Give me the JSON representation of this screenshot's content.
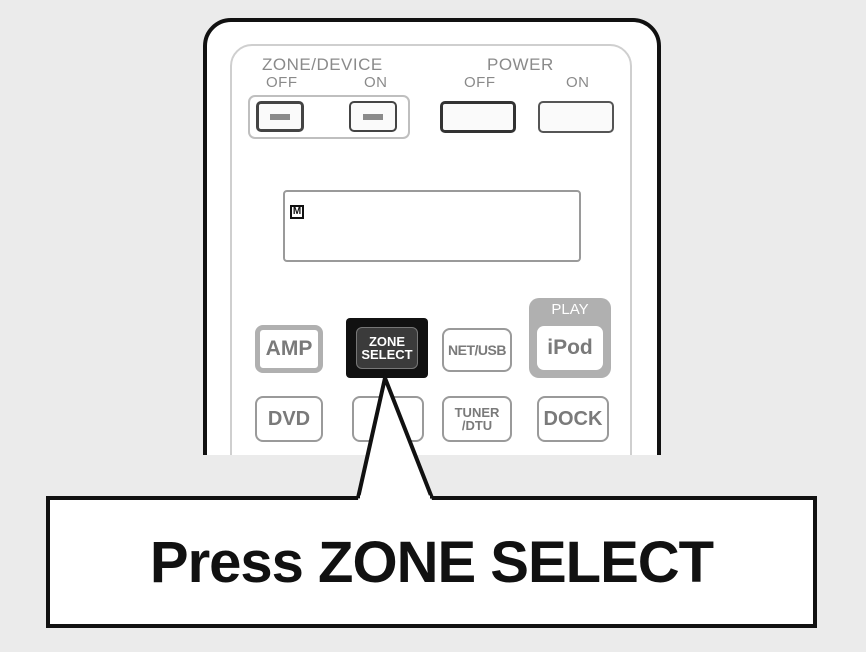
{
  "remote": {
    "zone_device_label": "ZONE/DEVICE",
    "zone_off_label": "OFF",
    "zone_on_label": "ON",
    "power_label": "POWER",
    "power_off_label": "OFF",
    "power_on_label": "ON",
    "display_indicator": "M",
    "buttons": {
      "amp": "AMP",
      "zone_select_line1": "ZONE",
      "zone_select_line2": "SELECT",
      "net_usb": "NET/USB",
      "play": "PLAY",
      "ipod": "iPod",
      "dvd": "DVD",
      "tuner_line1": "TUNER",
      "tuner_line2": "/DTU",
      "dock": "DOCK"
    }
  },
  "callout": {
    "text": "Press ZONE SELECT"
  },
  "colors": {
    "background": "#ebebeb",
    "remote_outline": "#111111",
    "highlighted_button": "#111111",
    "inactive_button_text": "#7a7a7a"
  }
}
